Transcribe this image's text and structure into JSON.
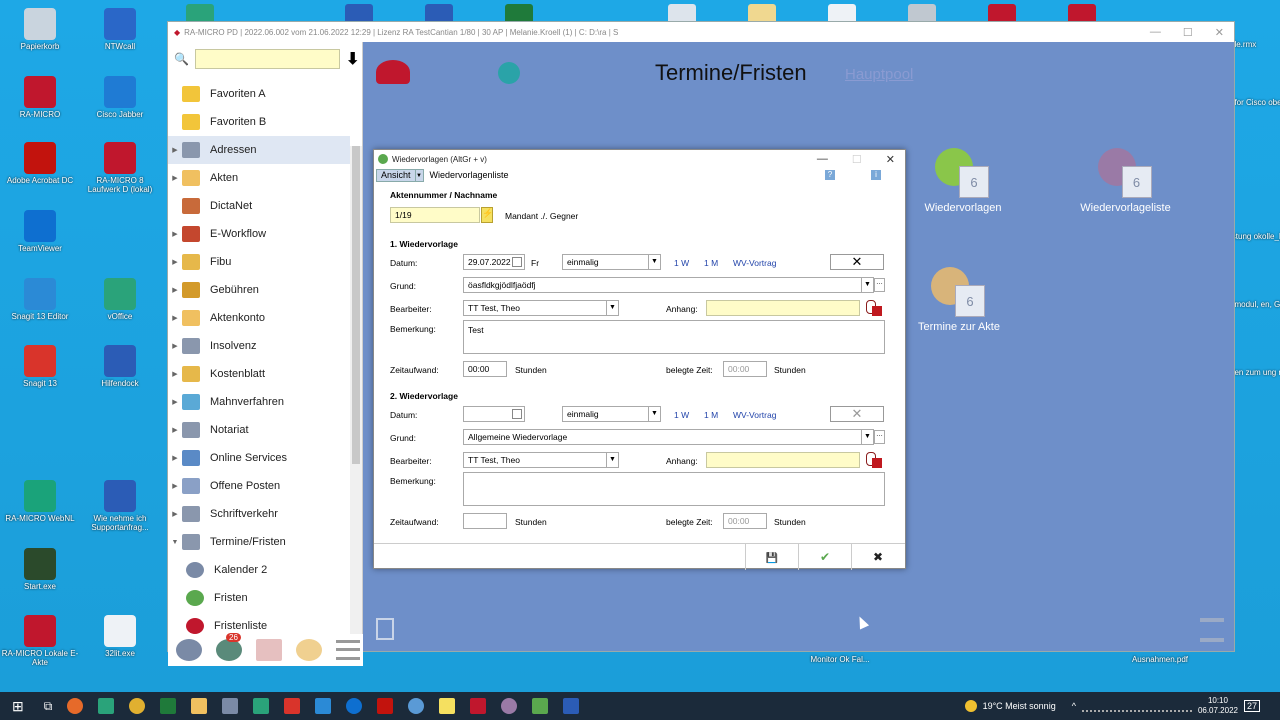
{
  "desktop_left": [
    {
      "label": "Papierkorb",
      "color": "#c9d4de"
    },
    {
      "label": "NTWcall",
      "color": "#2a67c8"
    },
    {
      "label": "RA-MICRO",
      "color": "#c0172d"
    },
    {
      "label": "Cisco Jabber",
      "color": "#1f7bd4"
    },
    {
      "label": "Adobe Acrobat DC",
      "color": "#c2130d"
    },
    {
      "label": "RA-MICRO 8 Laufwerk D (lokal)",
      "color": "#c0172d"
    },
    {
      "label": "TeamViewer",
      "color": "#0e6fd0"
    },
    {
      "label": "Snagit 13 Editor",
      "color": "#2b8ad6"
    },
    {
      "label": "vOffice",
      "color": "#2aa37a"
    },
    {
      "label": "Snagit 13",
      "color": "#d9342b"
    },
    {
      "label": "Hilfendock",
      "color": "#2b5cb6"
    },
    {
      "label": "RA-MICRO WebNL",
      "color": "#1aa37a"
    },
    {
      "label": "Wie nehme ich Supportanfrag...",
      "color": "#2b5cb6"
    },
    {
      "label": "Start.exe",
      "color": "#2b4a2b"
    },
    {
      "label": "RA-MICRO Lokale E-Akte",
      "color": "#c0172d"
    },
    {
      "label": "32lit.exe",
      "color": "#eef2f6"
    }
  ],
  "desktop_right": [
    {
      "label": "ole.rmx"
    },
    {
      "label": "t for Cisco ober"
    },
    {
      "label": "istung okolle_Lo..."
    },
    {
      "label": "dmodul, en, GNotK..."
    },
    {
      "label": "den zum ung mit P..."
    }
  ],
  "desktop_bottom": [
    {
      "label": "Monitor Ok Fal..."
    },
    {
      "label": "Ausnahmen.pdf"
    }
  ],
  "main_window": {
    "title": "RA-MICRO PD | 2022.06.002 vom 21.06.2022 12:29 | Lizenz RA TestCantian 1/80 | 30 AP | Melanie.Kroell (1) | C: D:\\ra | S",
    "heading": "Termine/Fristen",
    "link": "Hauptpool",
    "min": "—",
    "max": "☐",
    "close": "✕"
  },
  "nav": {
    "search_placeholder": "",
    "download_icon": "⬇",
    "search_icon": "🔍",
    "items": [
      {
        "label": "Favoriten A",
        "color": "#f2c53a",
        "arrow": ""
      },
      {
        "label": "Favoriten B",
        "color": "#f2c53a",
        "arrow": ""
      },
      {
        "label": "Adressen",
        "color": "#8a97ad",
        "arrow": "▶"
      },
      {
        "label": "Akten",
        "color": "#f0c060",
        "arrow": "▶"
      },
      {
        "label": "DictaNet",
        "color": "#c86a3a",
        "arrow": ""
      },
      {
        "label": "E-Workflow",
        "color": "#c4472e",
        "arrow": "▶"
      },
      {
        "label": "Fibu",
        "color": "#e6b84a",
        "arrow": "▶"
      },
      {
        "label": "Gebühren",
        "color": "#d39a2a",
        "arrow": "▶"
      },
      {
        "label": "Aktenkonto",
        "color": "#f0c060",
        "arrow": "▶"
      },
      {
        "label": "Insolvenz",
        "color": "#8a97ad",
        "arrow": "▶"
      },
      {
        "label": "Kostenblatt",
        "color": "#e6b84a",
        "arrow": "▶"
      },
      {
        "label": "Mahnverfahren",
        "color": "#5aa9d6",
        "arrow": "▶"
      },
      {
        "label": "Notariat",
        "color": "#8a97ad",
        "arrow": "▶"
      },
      {
        "label": "Online Services",
        "color": "#5a8ac6",
        "arrow": "▶"
      },
      {
        "label": "Offene Posten",
        "color": "#8aa0c6",
        "arrow": "▶"
      },
      {
        "label": "Schriftverkehr",
        "color": "#8a97ad",
        "arrow": "▶"
      },
      {
        "label": "Termine/Fristen",
        "color": "#8a97ad",
        "arrow": "▼"
      }
    ],
    "subitems": [
      {
        "label": "Kalender 2",
        "color": "#7a8aa6"
      },
      {
        "label": "Fristen",
        "color": "#5aa84e"
      },
      {
        "label": "Fristenliste",
        "color": "#c0172d"
      }
    ],
    "badge": "26"
  },
  "tiles": [
    {
      "label": "Wiedervorlagen",
      "count": "6",
      "color": "#8ac64a"
    },
    {
      "label": "Wiedervorlageliste",
      "count": "6",
      "color": "#9a7aa6"
    },
    {
      "label": "Termine zur Akte",
      "count": "6",
      "color": "#d8b47a"
    }
  ],
  "dialog": {
    "title": "Wiedervorlagen (AltGr + v)",
    "menu_ansicht": "Ansicht",
    "menu_list": "Wiedervorlagenliste",
    "help_icon": "?",
    "info_icon": "i",
    "min": "—",
    "max": "☐",
    "close": "✕",
    "aktennummer_label": "Aktennummer / Nachname",
    "aktennummer_value": "1/19",
    "mandant": "Mandant ./. Gegner",
    "wv1": {
      "heading": "1. Wiedervorlage",
      "datum_label": "Datum:",
      "datum_value": "29.07.2022",
      "weekday": "Fr",
      "freq": "einmalig",
      "link_1w": "1 W",
      "link_1m": "1 M",
      "link_wv": "WV-Vortrag",
      "clear": "✕",
      "grund_label": "Grund:",
      "grund_value": "öasfldkgjödlfjaödfj",
      "bearbeiter_label": "Bearbeiter:",
      "bearbeiter_value": "TT  Test, Theo",
      "anhang_label": "Anhang:",
      "bemerkung_label": "Bemerkung:",
      "bemerkung_value": "Test",
      "zeitaufwand_label": "Zeitaufwand:",
      "zeitaufwand_value": "00:00",
      "stunden": "Stunden",
      "belegte_label": "belegte Zeit:",
      "belegte_value": "00:00",
      "stunden2": "Stunden"
    },
    "wv2": {
      "heading": "2. Wiedervorlage",
      "datum_label": "Datum:",
      "datum_value": "",
      "freq": "einmalig",
      "link_1w": "1 W",
      "link_1m": "1 M",
      "link_wv": "WV-Vortrag",
      "clear": "✕",
      "grund_label": "Grund:",
      "grund_value": "Allgemeine Wiedervorlage",
      "bearbeiter_label": "Bearbeiter:",
      "bearbeiter_value": "TT  Test, Theo",
      "anhang_label": "Anhang:",
      "bemerkung_label": "Bemerkung:",
      "bemerkung_value": "",
      "zeitaufwand_label": "Zeitaufwand:",
      "zeitaufwand_value": "",
      "stunden": "Stunden",
      "belegte_label": "belegte Zeit:",
      "belegte_value": "00:00",
      "stunden2": "Stunden"
    },
    "save_icon": "💾",
    "ok_icon": "✔",
    "cancel_icon": "✖"
  },
  "taskbar": {
    "weather": "19°C  Meist sonnig",
    "time": "10:10",
    "date": "06.07.2022",
    "notif": "27",
    "start_icon": "⊞",
    "search_icon": "🔍",
    "taskview_icon": "⧉"
  }
}
